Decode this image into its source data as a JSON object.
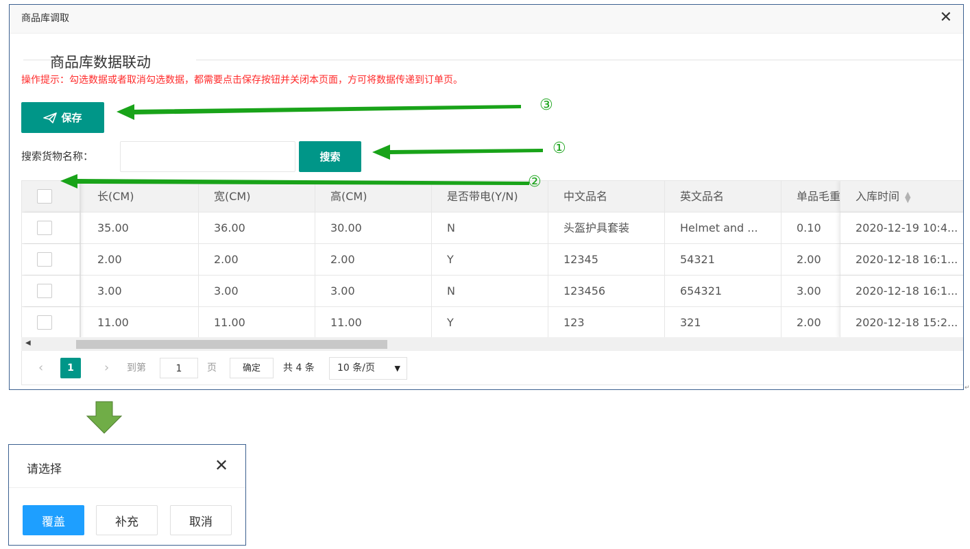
{
  "window": {
    "title": "商品库调取",
    "close_glyph": "✕",
    "section_title": "商品库数据联动",
    "tip": "操作提示：勾选数据或者取消勾选数据，都需要点击保存按钮并关闭本页面，方可将数据传递到订单页。"
  },
  "toolbar": {
    "save_label": "保存",
    "save_icon": "paper-plane-icon"
  },
  "search": {
    "label": "搜索货物名称：",
    "value": "",
    "placeholder": "",
    "button_label": "搜索"
  },
  "table": {
    "headers": [
      "长(CM)",
      "宽(CM)",
      "高(CM)",
      "是否带电(Y/N)",
      "中文品名",
      "英文品名",
      "单品毛重",
      "入库时间"
    ],
    "rows": [
      {
        "length": "35.00",
        "width": "36.00",
        "height": "30.00",
        "battery": "N",
        "cn_name": "头盔护具套装",
        "en_name": "Helmet and ...",
        "weight": "0.10",
        "time": "2020-12-19 10:4..."
      },
      {
        "length": "2.00",
        "width": "2.00",
        "height": "2.00",
        "battery": "Y",
        "cn_name": "12345",
        "en_name": "54321",
        "weight": "2.00",
        "time": "2020-12-18 16:1..."
      },
      {
        "length": "3.00",
        "width": "3.00",
        "height": "3.00",
        "battery": "N",
        "cn_name": "123456",
        "en_name": "654321",
        "weight": "3.00",
        "time": "2020-12-18 16:1..."
      },
      {
        "length": "11.00",
        "width": "11.00",
        "height": "11.00",
        "battery": "Y",
        "cn_name": "123",
        "en_name": "321",
        "weight": "2.00",
        "time": "2020-12-18 15:2..."
      }
    ]
  },
  "pager": {
    "prev": "‹",
    "current": "1",
    "next": "›",
    "goto_label": "到第",
    "goto_value": "1",
    "page_label": "页",
    "confirm_label": "确定",
    "total": "共 4 条",
    "page_size": "10 条/页"
  },
  "annotations": {
    "step1": "①",
    "step2": "②",
    "step3": "③",
    "arrow_color": "#19a319"
  },
  "dialog": {
    "title": "请选择",
    "close_glyph": "✕",
    "buttons": {
      "overwrite": "覆盖",
      "supplement": "补充",
      "cancel": "取消"
    }
  },
  "colors": {
    "primary": "#009688",
    "dialog_primary": "#1e9fff",
    "tip": "#ff2a2a",
    "arrow": "#19a319"
  }
}
